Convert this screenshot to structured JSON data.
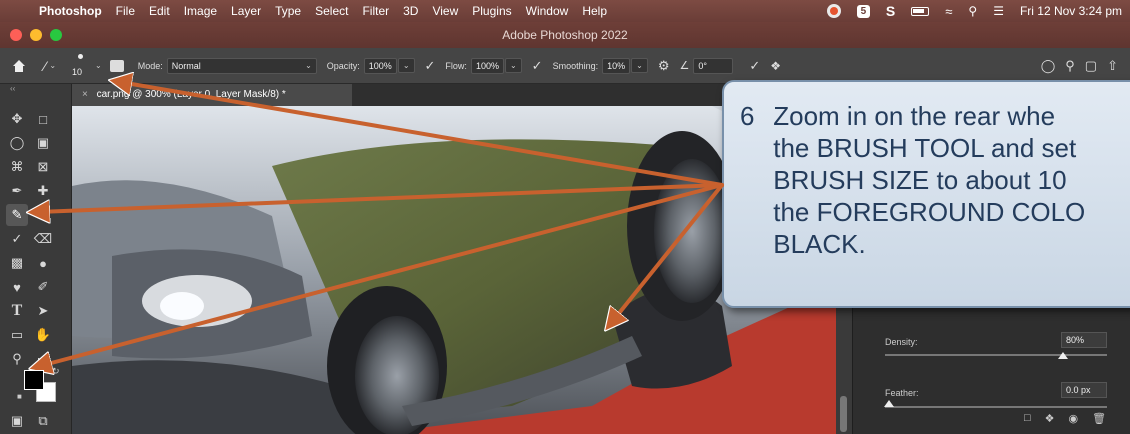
{
  "menubar": {
    "app": "Photoshop",
    "items": [
      "File",
      "Edit",
      "Image",
      "Layer",
      "Type",
      "Select",
      "Filter",
      "3D",
      "View",
      "Plugins",
      "Window",
      "Help"
    ],
    "clock": "Fri 12 Nov  3:24 pm"
  },
  "window": {
    "title": "Adobe Photoshop 2022"
  },
  "options": {
    "brush_size": "10",
    "mode_label": "Mode:",
    "mode_value": "Normal",
    "opacity_label": "Opacity:",
    "opacity_value": "100%",
    "flow_label": "Flow:",
    "flow_value": "100%",
    "smoothing_label": "Smoothing:",
    "smoothing_value": "10%",
    "angle_value": "0°"
  },
  "document": {
    "tab_label": "car.png @ 300% (Layer 0, Layer Mask/8) *"
  },
  "panel": {
    "density_label": "Density:",
    "density_value": "80%",
    "feather_label": "Feather:",
    "feather_value": "0.0 px",
    "density_fraction": 0.8,
    "feather_fraction": 0.0
  },
  "callout": {
    "step": "6",
    "lines": [
      "Zoom in on the rear whe",
      "the BRUSH TOOL and set",
      "BRUSH SIZE to about 10",
      "the FOREGROUND COLO",
      "BLACK."
    ]
  },
  "colors": {
    "menubar": "#6a3d37",
    "canvas_red": "#b83a2e",
    "arrow": "#c8612e",
    "callout_text": "#243c5c"
  }
}
